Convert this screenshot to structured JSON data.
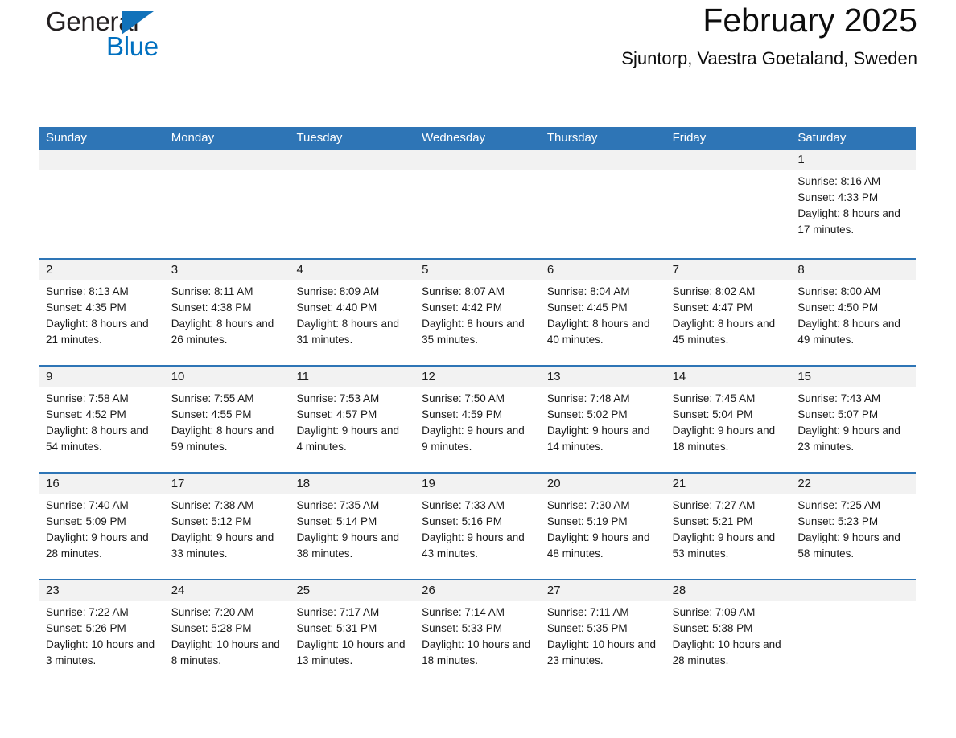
{
  "brand": {
    "name_part1": "General",
    "name_part2": "Blue",
    "accent_color": "#0070c0",
    "triangle_color": "#1172ba"
  },
  "header": {
    "title": "February 2025",
    "subtitle": "Sjuntorp, Vaestra Goetaland, Sweden",
    "header_bg": "#2e75b6"
  },
  "weekdays": [
    "Sunday",
    "Monday",
    "Tuesday",
    "Wednesday",
    "Thursday",
    "Friday",
    "Saturday"
  ],
  "weeks": [
    [
      {
        "day": "",
        "empty": true
      },
      {
        "day": "",
        "empty": true
      },
      {
        "day": "",
        "empty": true
      },
      {
        "day": "",
        "empty": true
      },
      {
        "day": "",
        "empty": true
      },
      {
        "day": "",
        "empty": true
      },
      {
        "day": "1",
        "sunrise": "Sunrise: 8:16 AM",
        "sunset": "Sunset: 4:33 PM",
        "daylight": "Daylight: 8 hours and 17 minutes."
      }
    ],
    [
      {
        "day": "2",
        "sunrise": "Sunrise: 8:13 AM",
        "sunset": "Sunset: 4:35 PM",
        "daylight": "Daylight: 8 hours and 21 minutes."
      },
      {
        "day": "3",
        "sunrise": "Sunrise: 8:11 AM",
        "sunset": "Sunset: 4:38 PM",
        "daylight": "Daylight: 8 hours and 26 minutes."
      },
      {
        "day": "4",
        "sunrise": "Sunrise: 8:09 AM",
        "sunset": "Sunset: 4:40 PM",
        "daylight": "Daylight: 8 hours and 31 minutes."
      },
      {
        "day": "5",
        "sunrise": "Sunrise: 8:07 AM",
        "sunset": "Sunset: 4:42 PM",
        "daylight": "Daylight: 8 hours and 35 minutes."
      },
      {
        "day": "6",
        "sunrise": "Sunrise: 8:04 AM",
        "sunset": "Sunset: 4:45 PM",
        "daylight": "Daylight: 8 hours and 40 minutes."
      },
      {
        "day": "7",
        "sunrise": "Sunrise: 8:02 AM",
        "sunset": "Sunset: 4:47 PM",
        "daylight": "Daylight: 8 hours and 45 minutes."
      },
      {
        "day": "8",
        "sunrise": "Sunrise: 8:00 AM",
        "sunset": "Sunset: 4:50 PM",
        "daylight": "Daylight: 8 hours and 49 minutes."
      }
    ],
    [
      {
        "day": "9",
        "sunrise": "Sunrise: 7:58 AM",
        "sunset": "Sunset: 4:52 PM",
        "daylight": "Daylight: 8 hours and 54 minutes."
      },
      {
        "day": "10",
        "sunrise": "Sunrise: 7:55 AM",
        "sunset": "Sunset: 4:55 PM",
        "daylight": "Daylight: 8 hours and 59 minutes."
      },
      {
        "day": "11",
        "sunrise": "Sunrise: 7:53 AM",
        "sunset": "Sunset: 4:57 PM",
        "daylight": "Daylight: 9 hours and 4 minutes."
      },
      {
        "day": "12",
        "sunrise": "Sunrise: 7:50 AM",
        "sunset": "Sunset: 4:59 PM",
        "daylight": "Daylight: 9 hours and 9 minutes."
      },
      {
        "day": "13",
        "sunrise": "Sunrise: 7:48 AM",
        "sunset": "Sunset: 5:02 PM",
        "daylight": "Daylight: 9 hours and 14 minutes."
      },
      {
        "day": "14",
        "sunrise": "Sunrise: 7:45 AM",
        "sunset": "Sunset: 5:04 PM",
        "daylight": "Daylight: 9 hours and 18 minutes."
      },
      {
        "day": "15",
        "sunrise": "Sunrise: 7:43 AM",
        "sunset": "Sunset: 5:07 PM",
        "daylight": "Daylight: 9 hours and 23 minutes."
      }
    ],
    [
      {
        "day": "16",
        "sunrise": "Sunrise: 7:40 AM",
        "sunset": "Sunset: 5:09 PM",
        "daylight": "Daylight: 9 hours and 28 minutes."
      },
      {
        "day": "17",
        "sunrise": "Sunrise: 7:38 AM",
        "sunset": "Sunset: 5:12 PM",
        "daylight": "Daylight: 9 hours and 33 minutes."
      },
      {
        "day": "18",
        "sunrise": "Sunrise: 7:35 AM",
        "sunset": "Sunset: 5:14 PM",
        "daylight": "Daylight: 9 hours and 38 minutes."
      },
      {
        "day": "19",
        "sunrise": "Sunrise: 7:33 AM",
        "sunset": "Sunset: 5:16 PM",
        "daylight": "Daylight: 9 hours and 43 minutes."
      },
      {
        "day": "20",
        "sunrise": "Sunrise: 7:30 AM",
        "sunset": "Sunset: 5:19 PM",
        "daylight": "Daylight: 9 hours and 48 minutes."
      },
      {
        "day": "21",
        "sunrise": "Sunrise: 7:27 AM",
        "sunset": "Sunset: 5:21 PM",
        "daylight": "Daylight: 9 hours and 53 minutes."
      },
      {
        "day": "22",
        "sunrise": "Sunrise: 7:25 AM",
        "sunset": "Sunset: 5:23 PM",
        "daylight": "Daylight: 9 hours and 58 minutes."
      }
    ],
    [
      {
        "day": "23",
        "sunrise": "Sunrise: 7:22 AM",
        "sunset": "Sunset: 5:26 PM",
        "daylight": "Daylight: 10 hours and 3 minutes."
      },
      {
        "day": "24",
        "sunrise": "Sunrise: 7:20 AM",
        "sunset": "Sunset: 5:28 PM",
        "daylight": "Daylight: 10 hours and 8 minutes."
      },
      {
        "day": "25",
        "sunrise": "Sunrise: 7:17 AM",
        "sunset": "Sunset: 5:31 PM",
        "daylight": "Daylight: 10 hours and 13 minutes."
      },
      {
        "day": "26",
        "sunrise": "Sunrise: 7:14 AM",
        "sunset": "Sunset: 5:33 PM",
        "daylight": "Daylight: 10 hours and 18 minutes."
      },
      {
        "day": "27",
        "sunrise": "Sunrise: 7:11 AM",
        "sunset": "Sunset: 5:35 PM",
        "daylight": "Daylight: 10 hours and 23 minutes."
      },
      {
        "day": "28",
        "sunrise": "Sunrise: 7:09 AM",
        "sunset": "Sunset: 5:38 PM",
        "daylight": "Daylight: 10 hours and 28 minutes."
      },
      {
        "day": "",
        "empty": true
      }
    ]
  ]
}
